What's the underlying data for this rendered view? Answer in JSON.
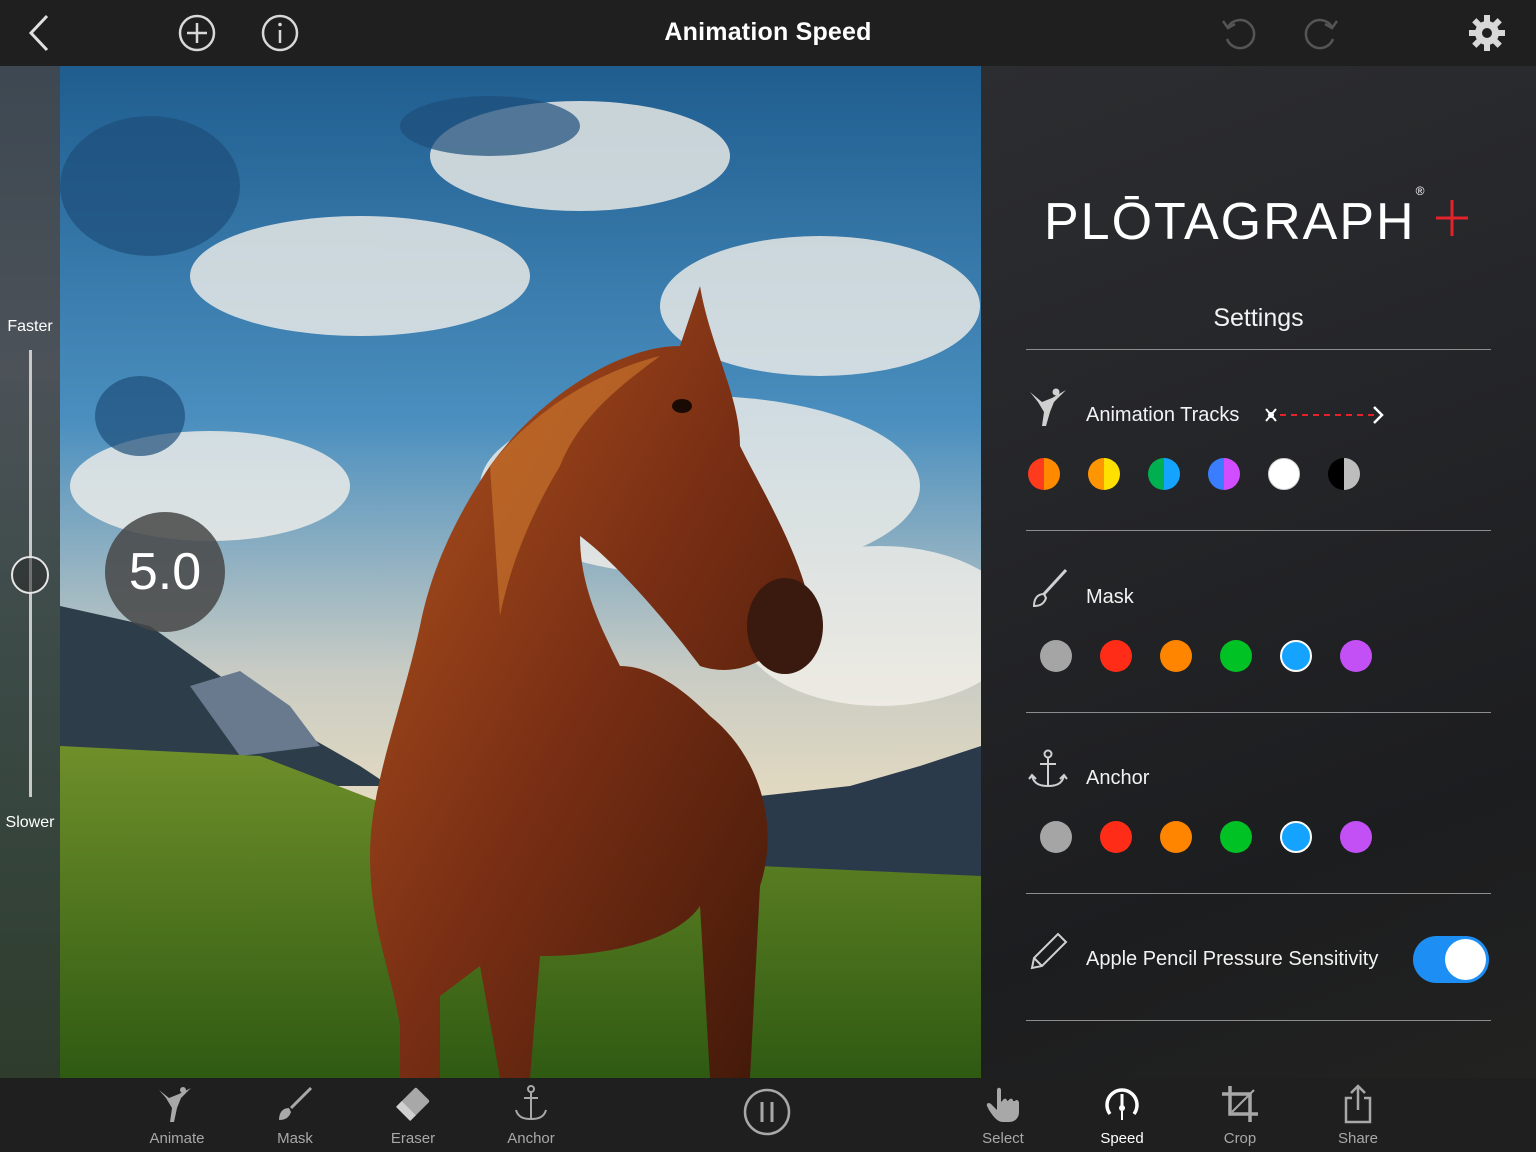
{
  "header": {
    "title": "Animation Speed",
    "back_icon": "chevron-left-icon",
    "add_icon": "plus-circle-icon",
    "info_icon": "info-circle-icon",
    "undo_icon": "undo-icon",
    "redo_icon": "redo-icon",
    "settings_icon": "gear-icon"
  },
  "speed_rail": {
    "top_label": "Faster",
    "bottom_label": "Slower",
    "value": "5.0"
  },
  "settings": {
    "logo_text": "PLŌTAGRAPH",
    "logo_mark": "®",
    "heading": "Settings",
    "animation_tracks": {
      "label": "Animation Tracks",
      "icon": "dancer-icon",
      "colors": [
        [
          "#ff3b1e",
          "#ff8a00"
        ],
        [
          "#ff9500",
          "#ffe000"
        ],
        [
          "#00b050",
          "#14a3ff"
        ],
        [
          "#3a7dff",
          "#d24dff"
        ],
        [
          "#ffffff",
          "#ffffff"
        ],
        [
          "#000000",
          "#bdbdbd"
        ]
      ]
    },
    "mask": {
      "label": "Mask",
      "icon": "brush-icon",
      "colors": [
        "#a5a5a5",
        "#ff2d17",
        "#ff8500",
        "#00c224",
        "#14a3ff",
        "#c350f5"
      ],
      "selected_index": 4
    },
    "anchor": {
      "label": "Anchor",
      "icon": "anchor-icon",
      "colors": [
        "#a5a5a5",
        "#ff2d17",
        "#ff8500",
        "#00c224",
        "#14a3ff",
        "#c350f5"
      ],
      "selected_index": 4
    },
    "pencil": {
      "label": "Apple Pencil Pressure Sensitivity",
      "icon": "pencil-icon",
      "enabled": true
    }
  },
  "toolbar": {
    "items": [
      {
        "label": "Animate",
        "icon": "dancer-icon"
      },
      {
        "label": "Mask",
        "icon": "brush-icon"
      },
      {
        "label": "Eraser",
        "icon": "eraser-icon"
      },
      {
        "label": "Anchor",
        "icon": "anchor-icon"
      },
      {
        "label": "Select",
        "icon": "hand-pointer-icon"
      },
      {
        "label": "Speed",
        "icon": "speedometer-icon",
        "active": true
      },
      {
        "label": "Crop",
        "icon": "crop-icon"
      },
      {
        "label": "Share",
        "icon": "share-icon"
      }
    ],
    "pause_icon": "pause-icon"
  },
  "colors": {
    "accent_blue": "#1d8ef4",
    "logo_plus": "#e3222c",
    "bar_bg": "#1f1f20"
  }
}
